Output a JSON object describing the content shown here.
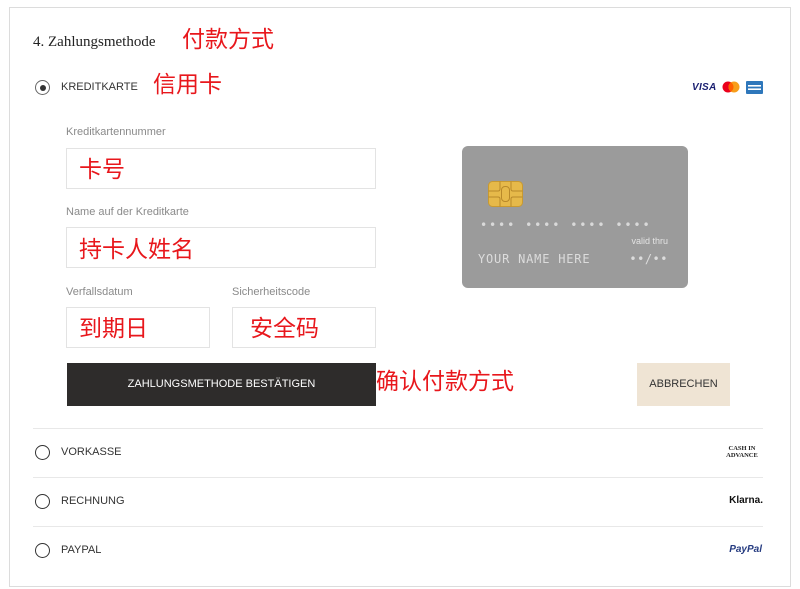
{
  "section": {
    "title": "4. Zahlungsmethode"
  },
  "annotations": {
    "section": "付款方式",
    "credit_card": "信用卡",
    "card_number": "卡号",
    "cardholder_name": "持卡人姓名",
    "expiry_date": "到期日",
    "security_code": "安全码",
    "confirm": "确认付款方式"
  },
  "payment_methods": [
    {
      "label": "KREDITKARTE",
      "selected": true,
      "logos": [
        {
          "icon": "visa-logo",
          "text": "VISA"
        },
        {
          "icon": "mastercard-logo"
        },
        {
          "icon": "amex-logo"
        }
      ]
    },
    {
      "label": "VORKASSE",
      "selected": false,
      "logo": {
        "icon": "cash-in-advance-logo",
        "lines": [
          "CASH IN",
          "ADVANCE"
        ]
      }
    },
    {
      "label": "RECHNUNG",
      "selected": false,
      "logo": {
        "icon": "klarna-logo",
        "text": "Klarna."
      }
    },
    {
      "label": "PAYPAL",
      "selected": false,
      "logo": {
        "icon": "paypal-logo",
        "text": "PayPal"
      }
    }
  ],
  "card_form": {
    "fields": {
      "card_number": {
        "label": "Kreditkartennummer",
        "value": ""
      },
      "cardholder_name": {
        "label": "Name auf der Kreditkarte",
        "value": ""
      },
      "expiry_date": {
        "label": "Verfallsdatum",
        "value": ""
      },
      "security_code": {
        "label": "Sicherheitscode",
        "value": ""
      }
    },
    "confirm_button": "ZAHLUNGSMETHODE BESTÄTIGEN",
    "cancel_button": "ABBRECHEN"
  },
  "card_preview": {
    "number": "•••• •••• •••• ••••",
    "valid_thru_label": "valid thru",
    "holder_name": "YOUR NAME HERE",
    "expiry": "••/••"
  },
  "colors": {
    "annotation_red": "#e8171c",
    "confirm_button_bg": "#2e2c2b",
    "cancel_button_bg": "#efe4d4",
    "card_preview_bg": "#9b9b9b",
    "chip_gold": "#e6b94a",
    "visa_blue": "#1a1f71",
    "amex_blue": "#2e77bb",
    "mastercard_red": "#eb001b",
    "mastercard_orange": "#f79e1b",
    "paypal_blue": "#253b80"
  }
}
